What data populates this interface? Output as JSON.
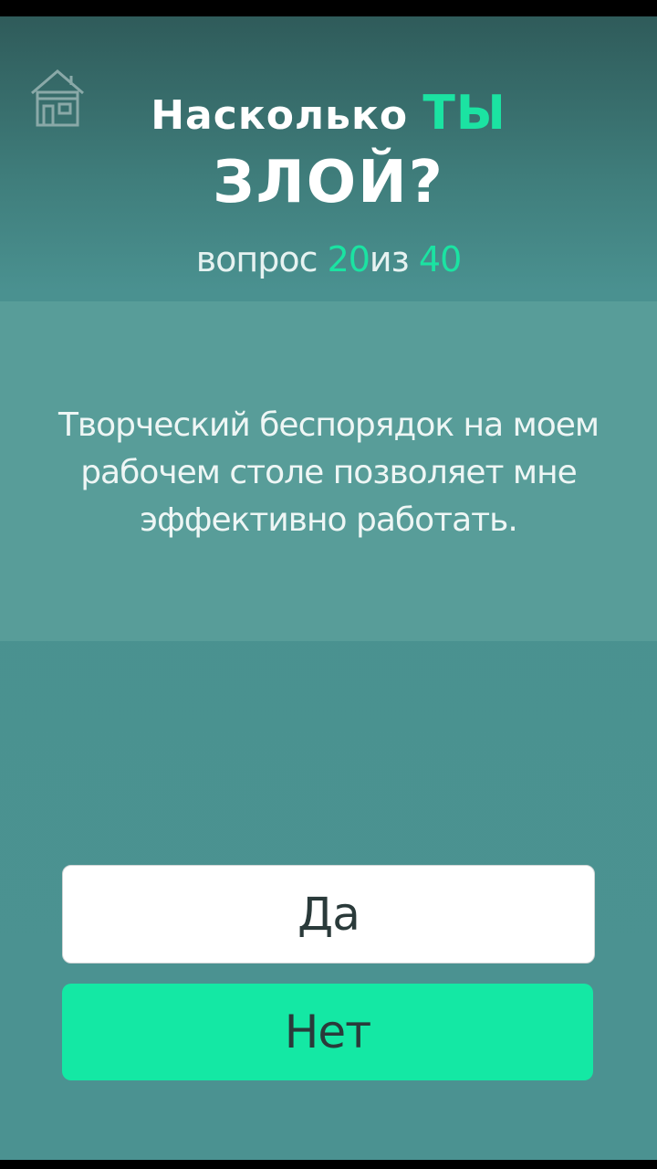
{
  "header": {
    "title_part1": "Насколько",
    "title_accent": "ТЫ",
    "title_line2": "ЗЛОЙ?",
    "home_icon": "house-icon"
  },
  "progress": {
    "prefix": "вопрос",
    "current": "20",
    "separator": "из",
    "total": "40"
  },
  "question": {
    "text": "Творческий беспорядок на моем рабочем столе позволяет мне эффективно работать."
  },
  "answers": {
    "yes_label": "Да",
    "no_label": "Нет"
  },
  "colors": {
    "accent": "#1be3a2",
    "background": "#4b9291",
    "panel": "#589d99",
    "no_button": "#14e8a4",
    "yes_button": "#ffffff"
  }
}
